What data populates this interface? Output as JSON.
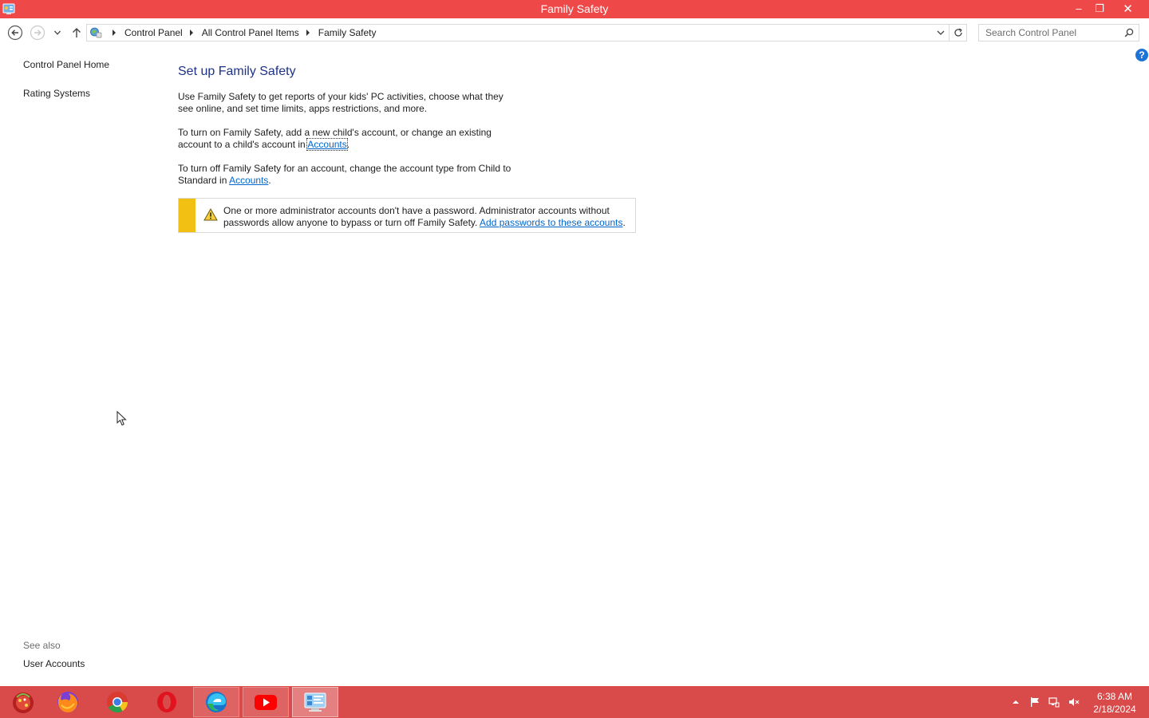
{
  "window": {
    "title": "Family Safety",
    "app_icon": "control-panel-icon",
    "minimize_glyph": "–",
    "maximize_glyph": "❐",
    "close_glyph": "✕"
  },
  "nav": {
    "breadcrumbs": [
      "Control Panel",
      "All Control Panel Items",
      "Family Safety"
    ],
    "search_placeholder": "Search Control Panel"
  },
  "help_glyph": "?",
  "left_pane": {
    "home_label": "Control Panel Home",
    "rating_label": "Rating Systems",
    "see_also_label": "See also",
    "user_accounts_label": "User Accounts"
  },
  "main": {
    "heading": "Set up Family Safety",
    "p1": "Use Family Safety to get reports of your kids' PC activities, choose what they see online, and set time limits, apps restrictions, and more.",
    "p2_before": "To turn on Family Safety, add a new child's account, or change an existing account to a child's account in ",
    "p2_link": "Accounts",
    "p2_after": ".",
    "p3_before": "To turn off Family Safety for an account, change the account type from Child to Standard in ",
    "p3_link": "Accounts",
    "p3_after": ".",
    "warning_text": "One or more administrator accounts don't have a password. Administrator accounts without passwords allow anyone to bypass or turn off Family Safety. ",
    "warning_link": "Add passwords to these accounts",
    "warning_after": "."
  },
  "colors": {
    "titlebar": "#ef4848",
    "taskbar": "#d94a4a",
    "heading": "#1e3287",
    "link": "#0066cc",
    "warning_stripe": "#f2c013"
  },
  "taskbar": {
    "items": [
      "start-icon",
      "firefox-icon",
      "chrome-icon",
      "opera-icon",
      "edge-icon",
      "youtube-icon",
      "control-panel-icon"
    ],
    "clock_time": "6:38 AM",
    "clock_date": "2/18/2024"
  }
}
